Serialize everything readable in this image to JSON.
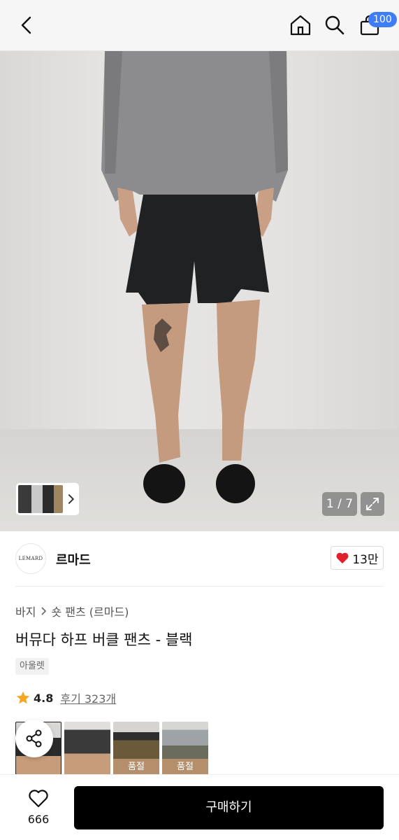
{
  "header": {
    "cart_badge": "100"
  },
  "gallery": {
    "counter": "1 / 7"
  },
  "brand": {
    "logo_text": "LEMARD",
    "name": "르마드",
    "like_count": "13만"
  },
  "product": {
    "breadcrumb": [
      "바지",
      "숏 팬츠 (르마드)"
    ],
    "title": "버뮤다 하프 버클 팬츠 - 블랙",
    "tag": "아울렛",
    "rating": "4.8",
    "review_link": "후기 323개"
  },
  "variants": [
    {
      "soldout": ""
    },
    {
      "soldout": ""
    },
    {
      "soldout": "품절"
    },
    {
      "soldout": "품절"
    }
  ],
  "bottom_bar": {
    "wish_count": "666",
    "buy_label": "구매하기"
  },
  "colors": {
    "badge": "#3f7df6",
    "heart": "#e0202a",
    "star": "#f5a623",
    "buy_button": "#000000"
  }
}
